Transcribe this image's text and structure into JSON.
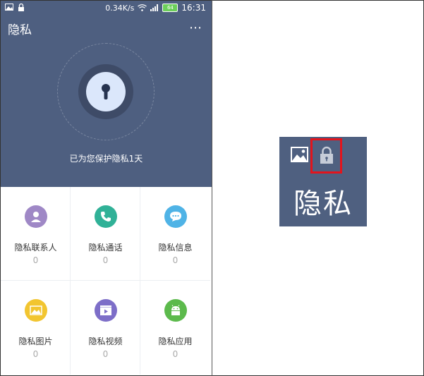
{
  "status_bar": {
    "speed": "0.34K/s",
    "time": "16:31",
    "battery": "64"
  },
  "app_bar": {
    "title": "隐私",
    "more": "⋯"
  },
  "header": {
    "protect_text": "已为您保护隐私1天"
  },
  "colors": {
    "header_bg": "#4e5f80",
    "badge_bg": "#4f6080",
    "highlight": "#e3141c"
  },
  "grid": {
    "items": [
      {
        "label": "隐私联系人",
        "count": "0",
        "icon": "contact-icon",
        "color": "#9f88c6"
      },
      {
        "label": "隐私通话",
        "count": "0",
        "icon": "phone-icon",
        "color": "#30b197"
      },
      {
        "label": "隐私信息",
        "count": "0",
        "icon": "message-icon",
        "color": "#4fb3e6"
      },
      {
        "label": "隐私图片",
        "count": "0",
        "icon": "picture-icon",
        "color": "#f2c530"
      },
      {
        "label": "隐私视频",
        "count": "0",
        "icon": "video-icon",
        "color": "#7d6ec8"
      },
      {
        "label": "隐私应用",
        "count": "0",
        "icon": "android-icon",
        "color": "#5cba4c"
      }
    ]
  },
  "badge": {
    "text": "隐私"
  }
}
